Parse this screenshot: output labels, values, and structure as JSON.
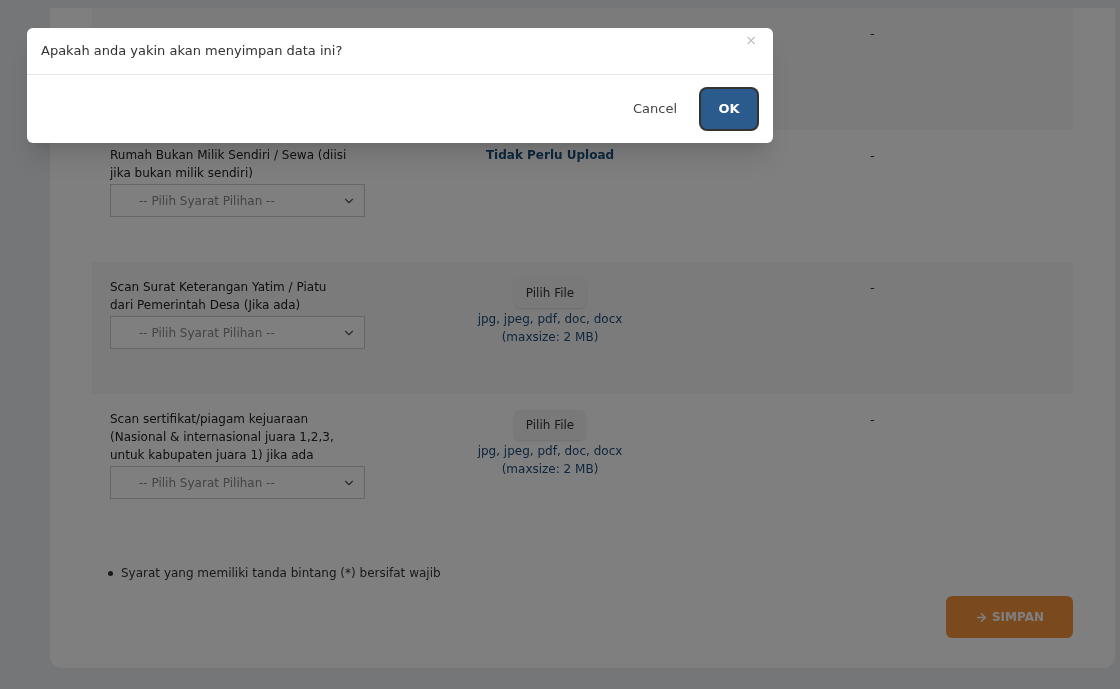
{
  "rows": [
    {
      "kind": "hidden",
      "status": "-"
    },
    {
      "kind": "no_upload",
      "label": "Rumah Bukan Milik Sendiri / Sewa (diisi jika bukan milik sendiri)",
      "select": "-- Pilih Syarat Pilihan --",
      "upload_note": "Tidak Perlu Upload",
      "status": "-"
    },
    {
      "kind": "upload",
      "label": "Scan Surat Keterangan Yatim / Piatu dari Pemerintah Desa (Jika ada)",
      "select": "-- Pilih Syarat Pilihan --",
      "file_button": "Pilih File",
      "formats": "jpg, jpeg, pdf, doc, docx",
      "maxsize": "(maxsize: 2 MB)",
      "status": "-"
    },
    {
      "kind": "upload",
      "label": "Scan sertifikat/piagam kejuaraan (Nasional & internasional juara 1,2,3, untuk kabupaten juara 1) jika ada",
      "select": "-- Pilih Syarat Pilihan --",
      "file_button": "Pilih File",
      "formats": "jpg, jpeg, pdf, doc, docx",
      "maxsize": "(maxsize: 2 MB)",
      "status": "-"
    }
  ],
  "note": "Syarat yang memiliki tanda bintang (*) bersifat wajib",
  "save_button": "SIMPAN",
  "dialog": {
    "message": "Apakah anda yakin akan menyimpan data ini?",
    "close": "×",
    "cancel": "Cancel",
    "ok": "OK"
  }
}
